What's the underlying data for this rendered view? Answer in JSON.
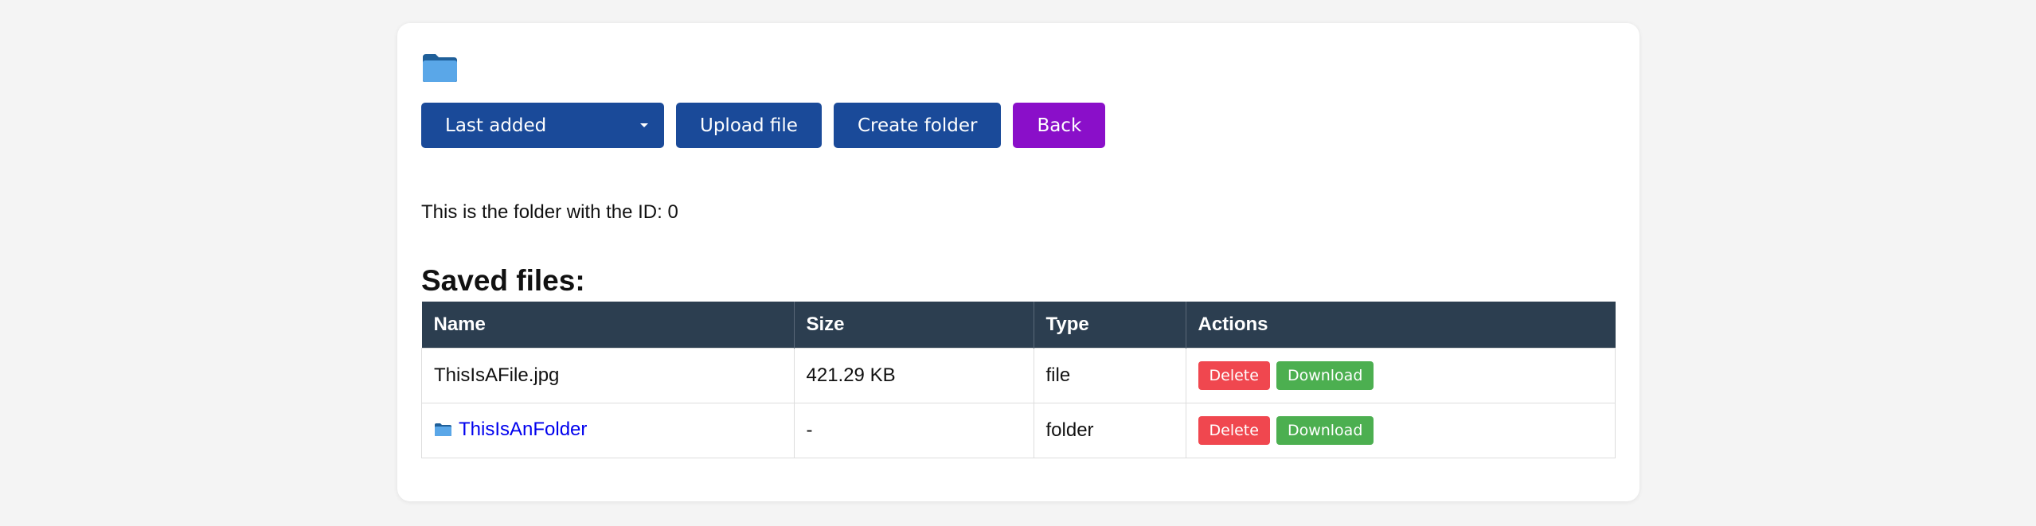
{
  "toolbar": {
    "sort_select_value": "Last added",
    "upload_label": "Upload file",
    "create_folder_label": "Create folder",
    "back_label": "Back"
  },
  "folder_info": "This is the folder with the ID: 0",
  "section_title": "Saved files:",
  "table": {
    "headers": [
      "Name",
      "Size",
      "Type",
      "Actions"
    ],
    "rows": [
      {
        "name": "ThisIsAFile.jpg",
        "size": "421.29 KB",
        "type": "file",
        "is_folder": false
      },
      {
        "name": "ThisIsAnFolder",
        "size": "-",
        "type": "folder",
        "is_folder": true
      }
    ],
    "delete_label": "Delete",
    "download_label": "Download"
  },
  "colors": {
    "primary": "#1a4a99",
    "back": "#8a0fc9",
    "header_bg": "#2c3e50",
    "delete": "#f0474f",
    "download": "#4caf50",
    "folder_icon": "#5aa7e8",
    "link": "#0000ee"
  },
  "icons": {
    "top": "folder-icon",
    "row": "folder-icon"
  }
}
